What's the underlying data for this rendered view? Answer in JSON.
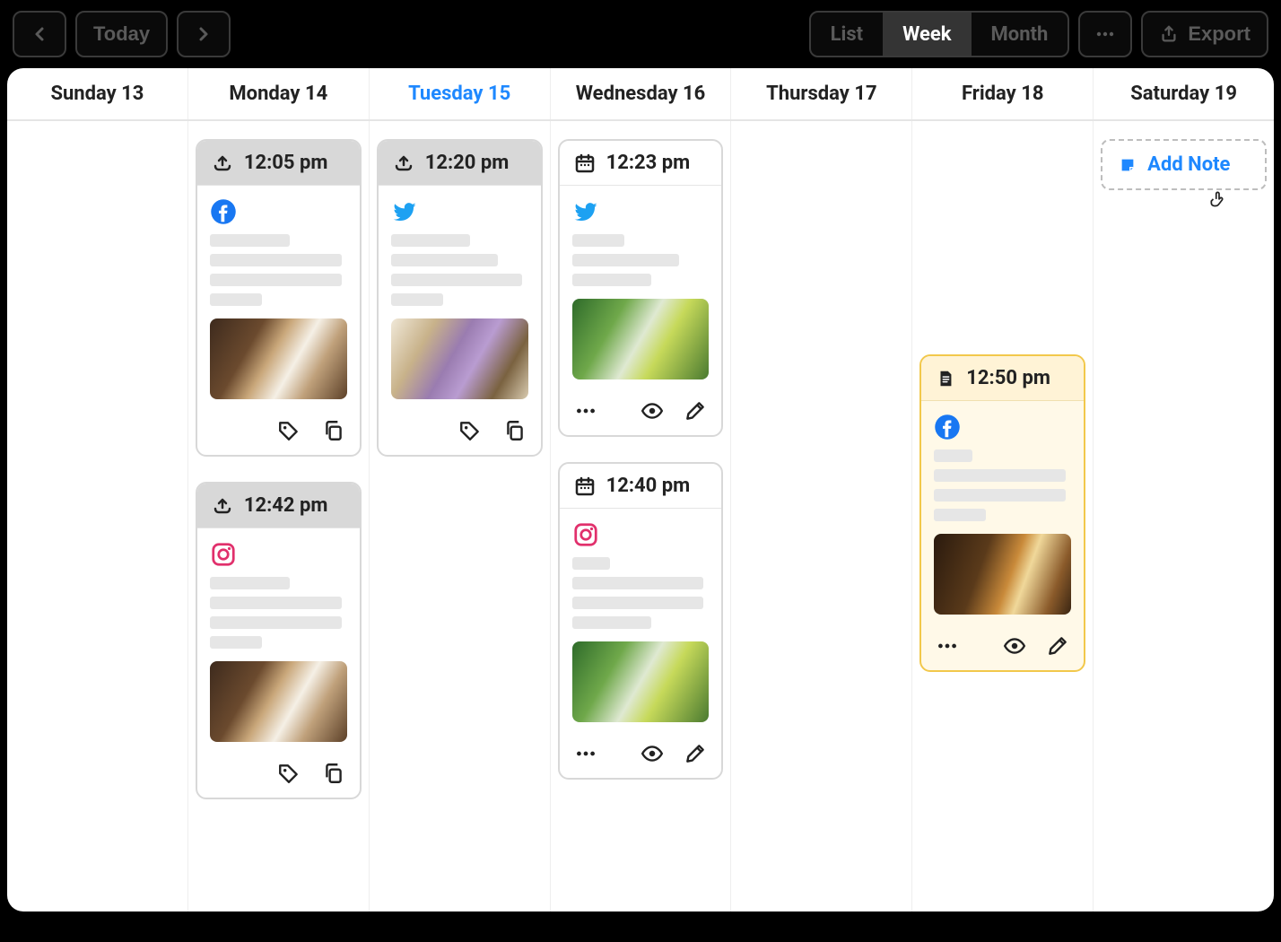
{
  "toolbar": {
    "today_label": "Today",
    "views": {
      "list": "List",
      "week": "Week",
      "month": "Month",
      "active": "Week"
    },
    "export_label": "Export"
  },
  "days": [
    {
      "label": "Sunday 13",
      "today": false
    },
    {
      "label": "Monday 14",
      "today": false
    },
    {
      "label": "Tuesday 15",
      "today": true
    },
    {
      "label": "Wednesday 16",
      "today": false
    },
    {
      "label": "Thursday 17",
      "today": false
    },
    {
      "label": "Friday 18",
      "today": false
    },
    {
      "label": "Saturday 19",
      "today": false
    }
  ],
  "add_note_label": "Add Note",
  "cards": {
    "mon1": {
      "time": "12:05 pm",
      "status": "queued",
      "status_icon": "upload-icon",
      "network": "facebook",
      "thumb": "coffee",
      "actions": [
        "tag",
        "copy"
      ]
    },
    "mon2": {
      "time": "12:42 pm",
      "status": "queued",
      "status_icon": "upload-icon",
      "network": "instagram",
      "thumb": "coffee",
      "actions": [
        "tag",
        "copy"
      ]
    },
    "tue1": {
      "time": "12:20 pm",
      "status": "queued",
      "status_icon": "upload-icon",
      "network": "twitter",
      "thumb": "lilac",
      "actions": [
        "tag",
        "copy"
      ]
    },
    "wed1": {
      "time": "12:23 pm",
      "status": "scheduled",
      "status_icon": "calendar-icon",
      "network": "twitter",
      "thumb": "matcha",
      "actions": [
        "more",
        "preview",
        "edit"
      ]
    },
    "wed2": {
      "time": "12:40 pm",
      "status": "scheduled",
      "status_icon": "calendar-icon",
      "network": "instagram",
      "thumb": "matcha",
      "actions": [
        "more",
        "preview",
        "edit"
      ]
    },
    "fri1": {
      "time": "12:50 pm",
      "status": "note",
      "status_icon": "note-icon",
      "network": "facebook",
      "thumb": "whiskey",
      "actions": [
        "more",
        "preview",
        "edit"
      ]
    }
  },
  "colors": {
    "accent_blue": "#1e88ff",
    "facebook": "#1877F2",
    "twitter": "#1DA1F2",
    "instagram": "#E1306C",
    "note_border": "#f2c84b"
  }
}
